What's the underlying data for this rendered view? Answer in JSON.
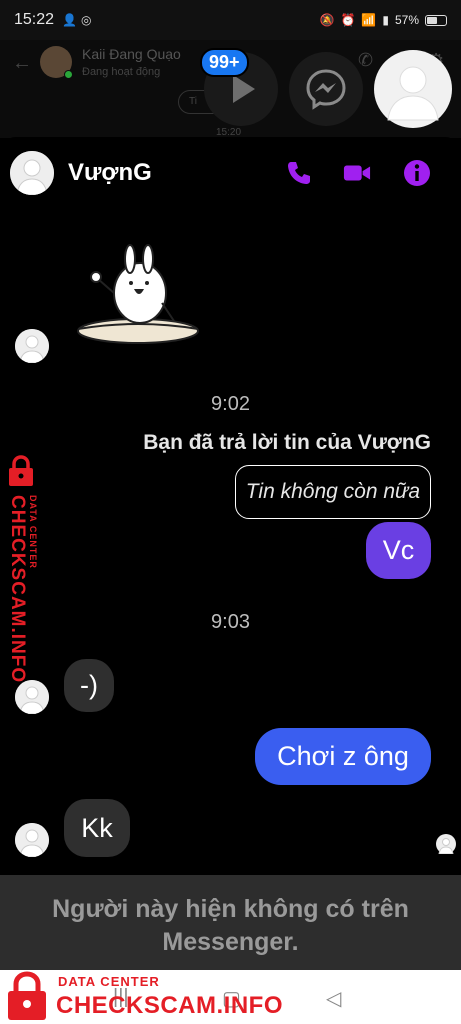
{
  "status_bar": {
    "time": "15:22",
    "battery": "57%",
    "battery_level": 0.57
  },
  "background_chat": {
    "contact_name": "Kaii Đang Quạo",
    "contact_status": "Đang hoạt động",
    "pill_text": "Ti",
    "timestamp": "15:20"
  },
  "chat_heads": {
    "unread_badge": "99+"
  },
  "chat": {
    "contact_name": "VượnG",
    "messages": {
      "time_1": "9:02",
      "reply_label": "Bạn đã trả lời tin của VượnG",
      "reply_quote": "Tin không còn nữa",
      "sent_1": "Vc",
      "time_2": "9:03",
      "received_1": "-)",
      "sent_2": "Chơi z ông",
      "received_2": "Kk"
    },
    "unavailable_line_1": "Người này hiện không có trên",
    "unavailable_line_2": "Messenger.",
    "colors": {
      "accent": "#a020f0",
      "sent_bubble_purple": "#6a3fe3",
      "sent_bubble_blue": "#3a5ef0",
      "received_bubble": "#2f2f2f"
    }
  },
  "watermark": {
    "small": "DATA CENTER",
    "big": "CHECKSCAM.INFO",
    "color": "#e41e26"
  }
}
